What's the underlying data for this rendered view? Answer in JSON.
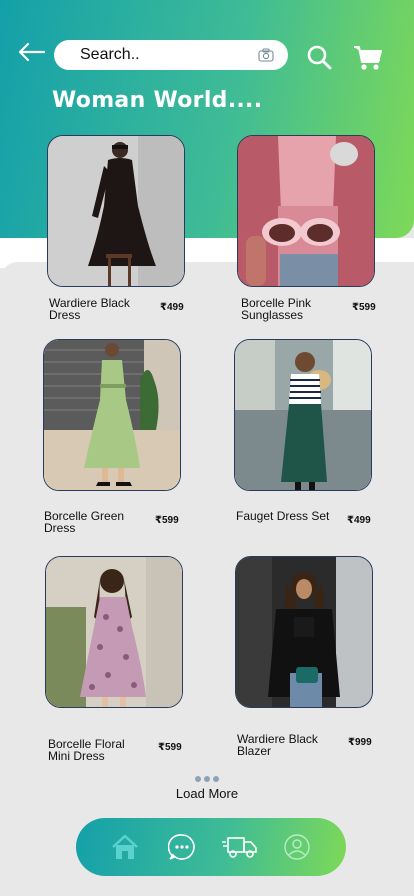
{
  "header": {
    "title": "Woman World....",
    "search": {
      "value": "Search..",
      "placeholder": "Search.."
    }
  },
  "products": [
    {
      "name": "Wardiere Black Dress",
      "price": "₹499",
      "image": "woman-black-dress-photo"
    },
    {
      "name": "Borcelle Pink Sunglasses",
      "price": "₹599",
      "image": "pink-sunglasses-photo"
    },
    {
      "name": "Borcelle Green Dress",
      "price": "₹599",
      "image": "green-dress-photo"
    },
    {
      "name": "Fauget Dress Set",
      "price": "₹499",
      "image": "striped-top-green-skirt-photo"
    },
    {
      "name": "Borcelle Floral Mini Dress",
      "price": "₹599",
      "image": "floral-mini-dress-photo"
    },
    {
      "name": "Wardiere Black Blazer",
      "price": "₹999",
      "image": "black-leather-jacket-photo"
    }
  ],
  "load_more": {
    "label": "Load More"
  },
  "bottom_nav": {
    "items": [
      "home-icon",
      "chat-icon",
      "delivery-truck-icon",
      "profile-icon"
    ]
  },
  "colors": {
    "gradient_start": "#14a0aa",
    "gradient_end": "#7ed957",
    "background": "#e8e8e8"
  }
}
